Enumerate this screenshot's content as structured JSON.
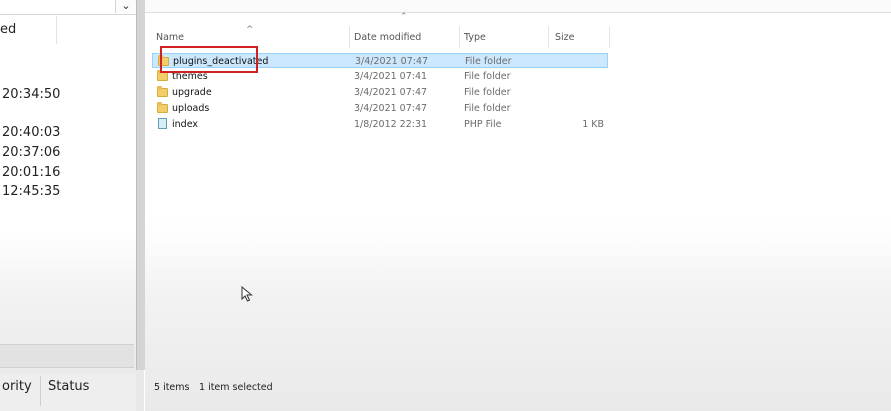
{
  "left_pane": {
    "column_header": "ed",
    "times": [
      "20:34:50",
      "20:40:03",
      "20:37:06",
      "20:01:16",
      "12:45:35"
    ],
    "bottom_headers": [
      "ority",
      "Status"
    ]
  },
  "file_list": {
    "columns": {
      "name": "Name",
      "date": "Date modified",
      "type": "Type",
      "size": "Size"
    },
    "rows": [
      {
        "name": "plugins_deactivated",
        "date": "3/4/2021 07:47",
        "type": "File folder",
        "size": "",
        "icon": "folder-icon",
        "selected": true
      },
      {
        "name": "themes",
        "date": "3/4/2021 07:41",
        "type": "File folder",
        "size": "",
        "icon": "folder-icon",
        "selected": false
      },
      {
        "name": "upgrade",
        "date": "3/4/2021 07:47",
        "type": "File folder",
        "size": "",
        "icon": "folder-icon",
        "selected": false
      },
      {
        "name": "uploads",
        "date": "3/4/2021 07:47",
        "type": "File folder",
        "size": "",
        "icon": "folder-icon",
        "selected": false
      },
      {
        "name": "index",
        "date": "1/8/2012 22:31",
        "type": "PHP File",
        "size": "1 KB",
        "icon": "php-file-icon",
        "selected": false
      }
    ]
  },
  "status_bar": {
    "item_count": "5 items",
    "selection": "1 item selected"
  },
  "colors": {
    "selection_bg": "#cce8ff",
    "highlight_box": "#d12020"
  }
}
